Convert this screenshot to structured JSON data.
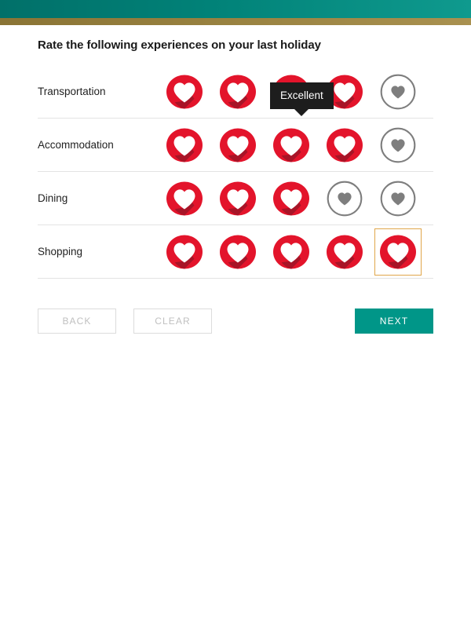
{
  "header": {
    "teal_bar_color": "#018278",
    "gold_bar_color": "#9b8442"
  },
  "survey": {
    "title": "Rate the following experiences on your last holiday",
    "max_rating": 5,
    "rows": [
      {
        "label": "Transportation",
        "rating": 4
      },
      {
        "label": "Accommodation",
        "rating": 4
      },
      {
        "label": "Dining",
        "rating": 3
      },
      {
        "label": "Shopping",
        "rating": 5
      }
    ],
    "focused": {
      "row": "Shopping",
      "index": 5
    },
    "tooltip": {
      "text": "Excellent",
      "visible": true
    }
  },
  "icons": {
    "filled_heart": "heart-filled-icon",
    "empty_heart": "heart-empty-icon"
  },
  "colors": {
    "heart_red": "#E3142B",
    "heart_shadow": "#A81427",
    "heart_white": "#FFFFFF",
    "heart_gray": "#7E7E7E",
    "focus_outline": "#E0A64A",
    "tooltip_bg": "#1D1D1D",
    "next_teal": "#009688",
    "disabled_text": "#C0C0C0"
  },
  "buttons": {
    "back_label": "BACK",
    "clear_label": "CLEAR",
    "next_label": "NEXT"
  }
}
